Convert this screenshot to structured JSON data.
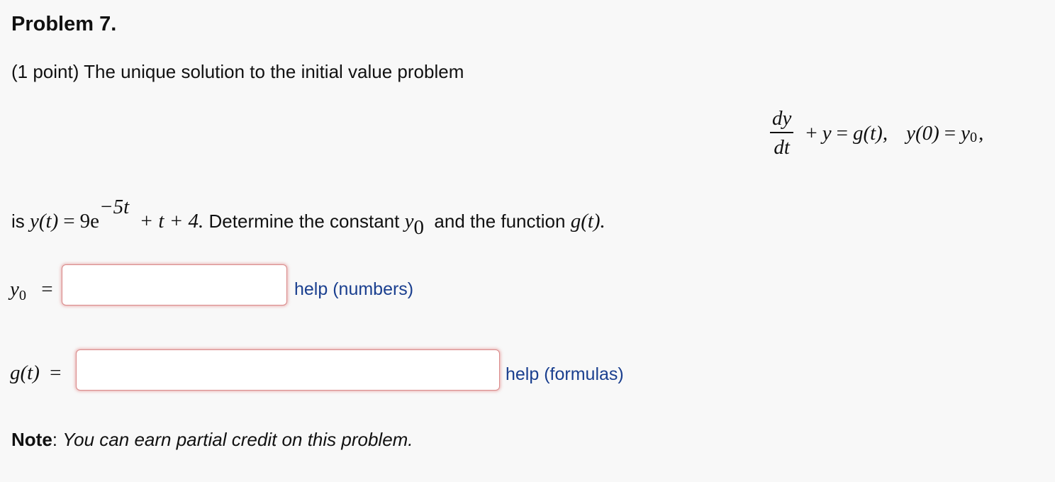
{
  "problem": {
    "title": "Problem 7.",
    "intro": "(1 point) The unique solution to the initial value problem",
    "equation": {
      "numerator": "dy",
      "denominator": "dt",
      "plus": "+",
      "y": "y",
      "equals": "=",
      "g_of_t": "g(t),",
      "y_zero": "y(0)",
      "equals2": "=",
      "subscript": "0",
      "trailing": ","
    },
    "solution_prefix": "is",
    "solution": {
      "lhs": "y(t)",
      "equals": "=",
      "coefficient": "9e",
      "exponent": "−5t",
      "rest": "+ t + 4."
    },
    "solution_text": "Determine the constant",
    "constant_symbol": "y",
    "constant_subscript": "0",
    "solution_and": "and the function",
    "function_symbol": "g(t)."
  },
  "answers": {
    "y0": {
      "symbol": "y",
      "subscript": "0",
      "equals": "=",
      "value": "",
      "help_label": "help (numbers)"
    },
    "g": {
      "symbol": "g(t)",
      "equals": "=",
      "value": "",
      "help_label": "help (formulas)"
    }
  },
  "note": {
    "label": "Note",
    "colon": ":",
    "body": "You can earn partial credit on this problem."
  },
  "colors": {
    "background": "#f8f8f8",
    "link": "#1a3f8f",
    "input_border": "#d98a8a"
  }
}
